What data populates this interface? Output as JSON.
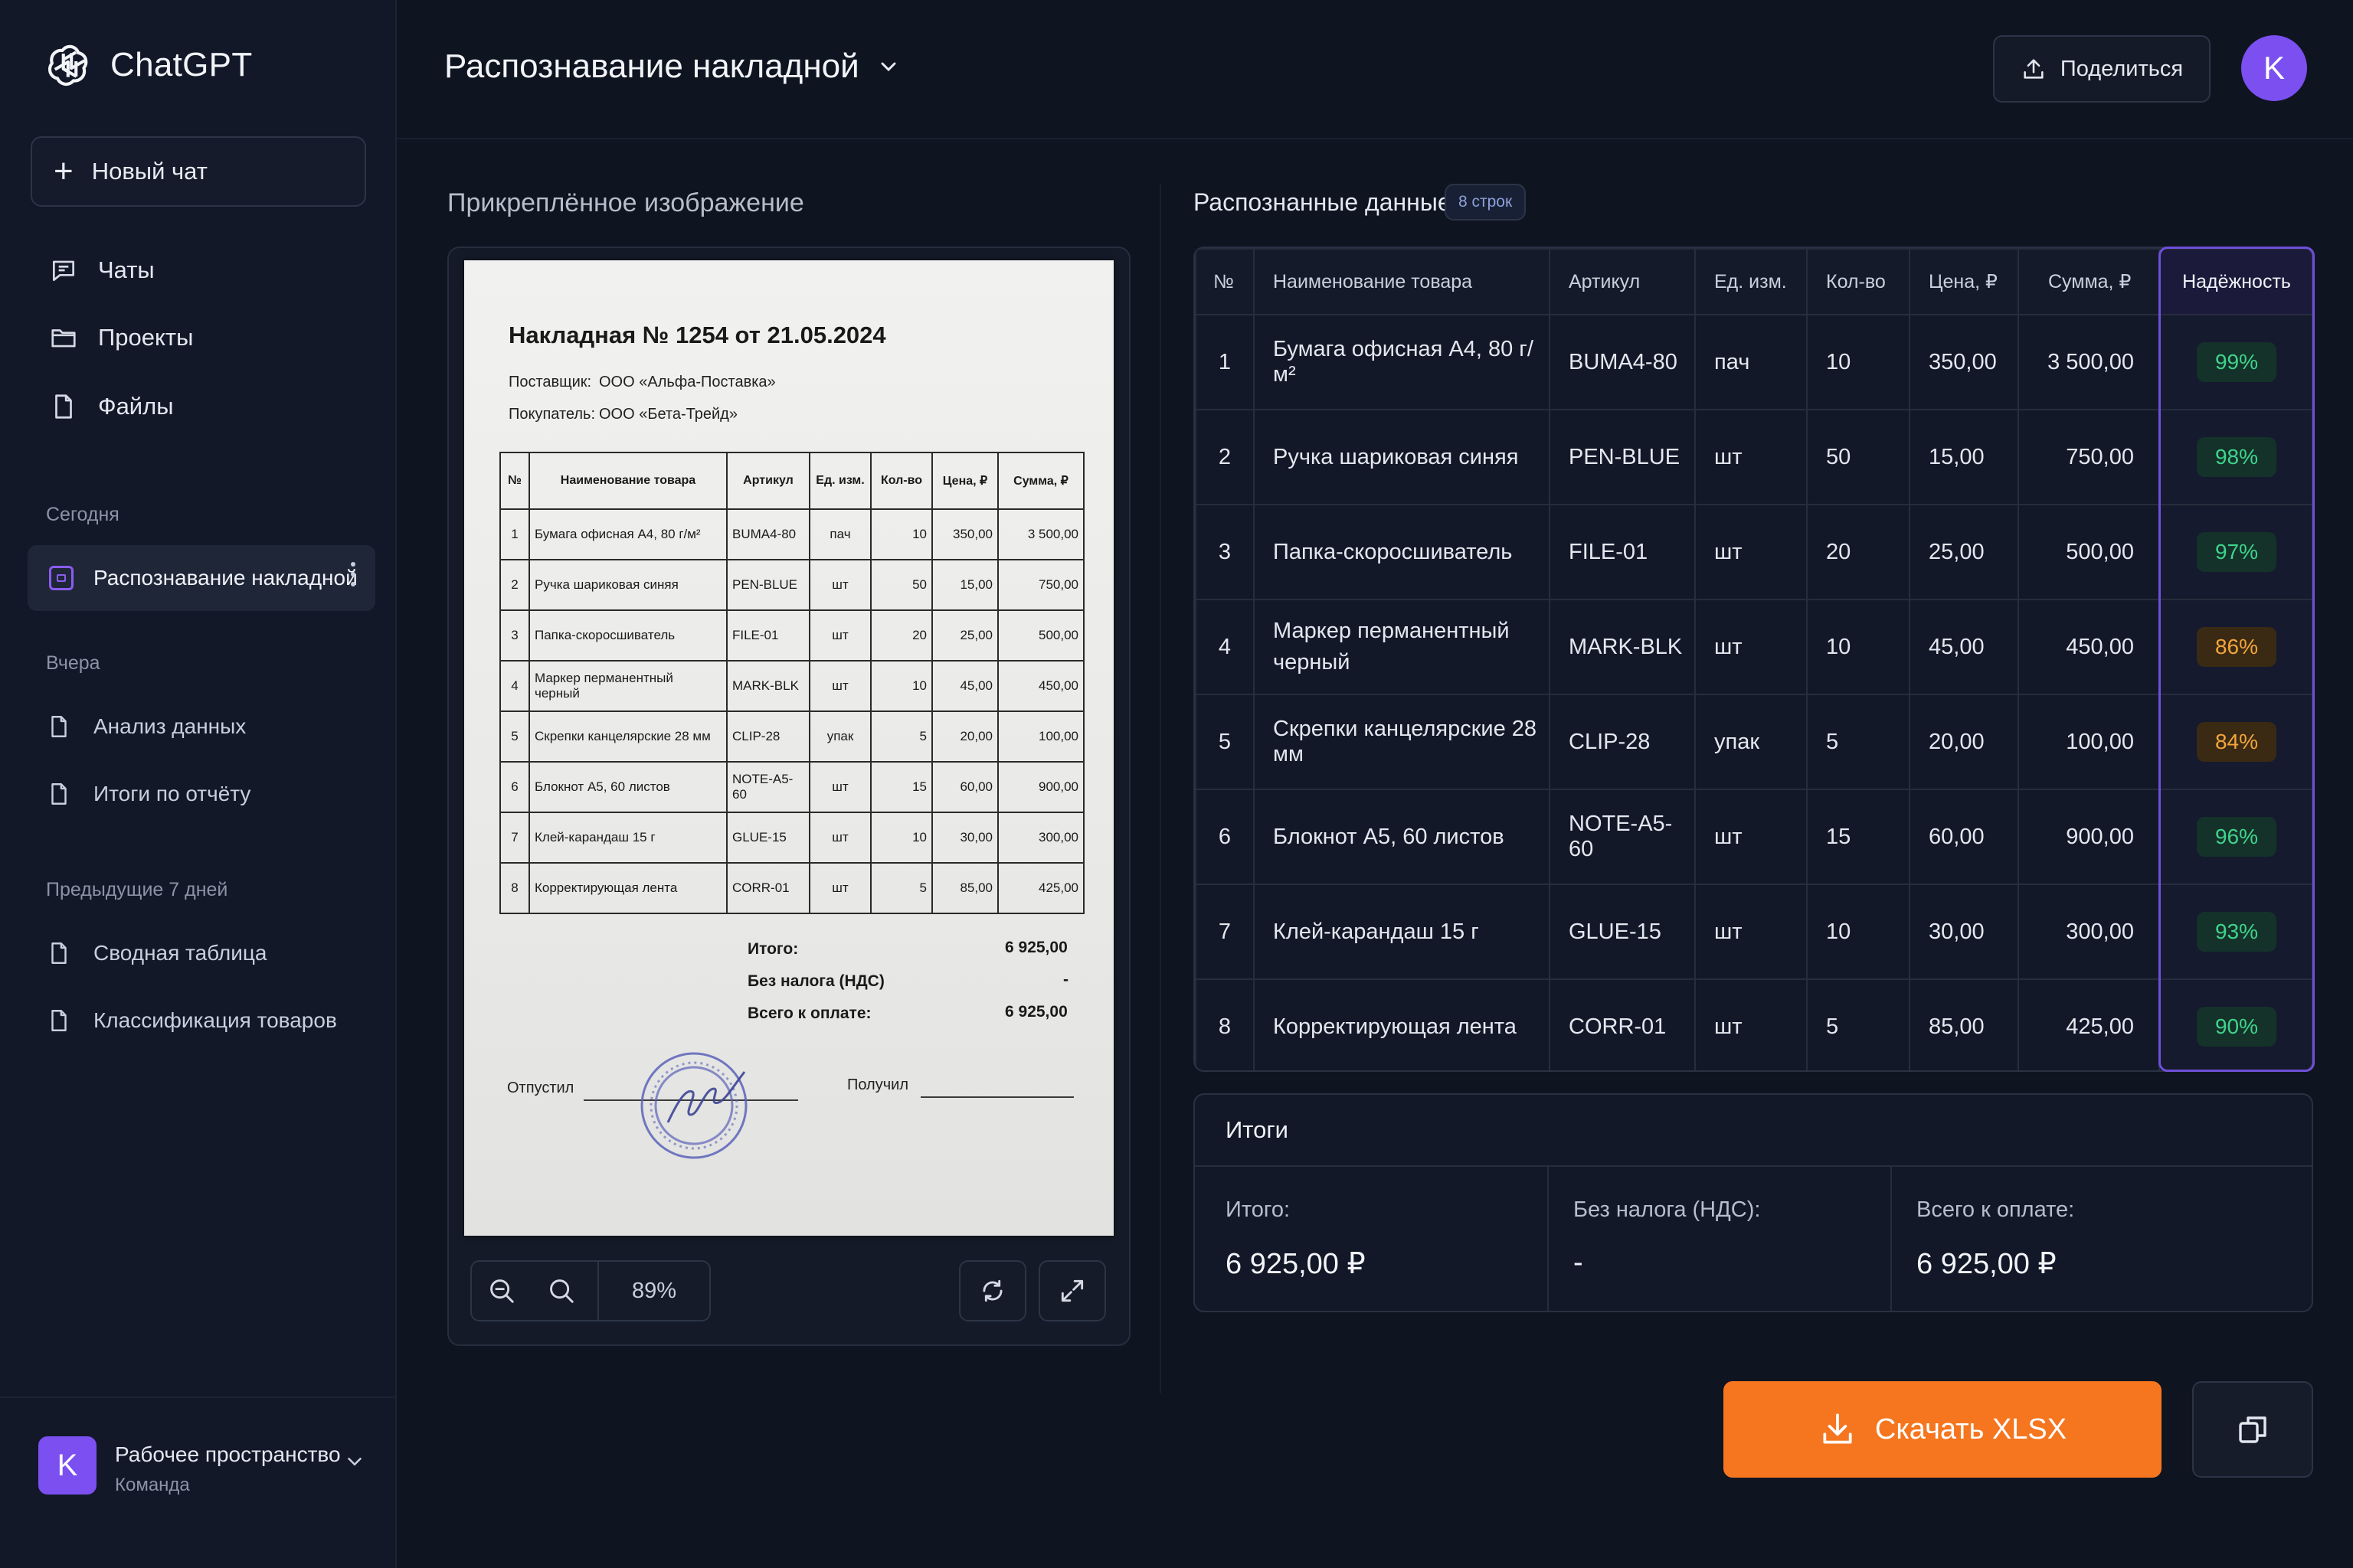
{
  "app": {
    "name": "ChatGPT"
  },
  "sidebar": {
    "new_chat": "Новый чат",
    "nav": [
      {
        "label": "Чаты",
        "icon": "chat-icon"
      },
      {
        "label": "Проекты",
        "icon": "folder-icon"
      },
      {
        "label": "Файлы",
        "icon": "file-icon"
      }
    ],
    "sections": {
      "today": "Сегодня",
      "yesterday": "Вчера",
      "prev7": "Предыдущие 7 дней"
    },
    "today_items": [
      {
        "label": "Распознавание накладной",
        "active": true
      }
    ],
    "yesterday_items": [
      {
        "label": "Анализ данных"
      },
      {
        "label": "Итоги по отчёту"
      }
    ],
    "prev7_items": [
      {
        "label": "Сводная таблица"
      },
      {
        "label": "Классификация товаров"
      }
    ],
    "workspace": {
      "avatar": "K",
      "title": "Рабочее пространство",
      "subtitle": "Команда"
    }
  },
  "header": {
    "title": "Распознавание накладной",
    "share": "Поделиться",
    "user_avatar": "K"
  },
  "image_panel": {
    "title": "Прикреплённое изображение",
    "zoom": "89%"
  },
  "document": {
    "title": "Накладная № 1254 от 21.05.2024",
    "supplier_label": "Поставщик:",
    "supplier": "ООО «Альфа-Поставка»",
    "buyer_label": "Покупатель:",
    "buyer": "ООО «Бета-Трейд»",
    "headers": [
      "№",
      "Наименование товара",
      "Артикул",
      "Ед. изм.",
      "Кол-во",
      "Цена, ₽",
      "Сумма, ₽"
    ],
    "rows": [
      [
        "1",
        "Бумага офисная А4, 80 г/м²",
        "BUMA4-80",
        "пач",
        "10",
        "350,00",
        "3 500,00"
      ],
      [
        "2",
        "Ручка шариковая синяя",
        "PEN-BLUE",
        "шт",
        "50",
        "15,00",
        "750,00"
      ],
      [
        "3",
        "Папка-скоросшиватель",
        "FILE-01",
        "шт",
        "20",
        "25,00",
        "500,00"
      ],
      [
        "4",
        "Маркер перманентный черный",
        "MARK-BLK",
        "шт",
        "10",
        "45,00",
        "450,00"
      ],
      [
        "5",
        "Скрепки канцелярские 28 мм",
        "CLIP-28",
        "упак",
        "5",
        "20,00",
        "100,00"
      ],
      [
        "6",
        "Блокнот А5, 60 листов",
        "NOTE-A5-60",
        "шт",
        "15",
        "60,00",
        "900,00"
      ],
      [
        "7",
        "Клей-карандаш 15 г",
        "GLUE-15",
        "шт",
        "10",
        "30,00",
        "300,00"
      ],
      [
        "8",
        "Корректирующая лента",
        "CORR-01",
        "шт",
        "5",
        "85,00",
        "425,00"
      ]
    ],
    "total_label": "Итого:",
    "total": "6 925,00",
    "vat_label": "Без налога (НДС)",
    "vat": "-",
    "pay_label": "Всего к оплате:",
    "pay": "6 925,00",
    "released": "Отпустил",
    "received": "Получил"
  },
  "data_panel": {
    "title": "Распознанные данные",
    "rows_badge": "8 строк",
    "headers": [
      "№",
      "Наименование товара",
      "Артикул",
      "Ед. изм.",
      "Кол-во",
      "Цена, ₽",
      "Сумма, ₽",
      "Надёжность"
    ],
    "rows": [
      {
        "n": "1",
        "name": "Бумага офисная А4, 80 г/м²",
        "sku": "BUMA4-80",
        "unit": "пач",
        "qty": "10",
        "price": "350,00",
        "sum": "3 500,00",
        "conf": "99%",
        "level": "hi"
      },
      {
        "n": "2",
        "name": "Ручка шариковая синяя",
        "sku": "PEN-BLUE",
        "unit": "шт",
        "qty": "50",
        "price": "15,00",
        "sum": "750,00",
        "conf": "98%",
        "level": "hi"
      },
      {
        "n": "3",
        "name": "Папка-скоросшиватель",
        "sku": "FILE-01",
        "unit": "шт",
        "qty": "20",
        "price": "25,00",
        "sum": "500,00",
        "conf": "97%",
        "level": "hi"
      },
      {
        "n": "4",
        "name": "Маркер перманентный черный",
        "sku": "MARK-BLK",
        "unit": "шт",
        "qty": "10",
        "price": "45,00",
        "sum": "450,00",
        "conf": "86%",
        "level": "mid"
      },
      {
        "n": "5",
        "name": "Скрепки канцелярские 28 мм",
        "sku": "CLIP-28",
        "unit": "упак",
        "qty": "5",
        "price": "20,00",
        "sum": "100,00",
        "conf": "84%",
        "level": "mid"
      },
      {
        "n": "6",
        "name": "Блокнот А5, 60 листов",
        "sku": "NOTE-A5-60",
        "unit": "шт",
        "qty": "15",
        "price": "60,00",
        "sum": "900,00",
        "conf": "96%",
        "level": "hi"
      },
      {
        "n": "7",
        "name": "Клей-карандаш 15 г",
        "sku": "GLUE-15",
        "unit": "шт",
        "qty": "10",
        "price": "30,00",
        "sum": "300,00",
        "conf": "93%",
        "level": "hi"
      },
      {
        "n": "8",
        "name": "Корректирующая лента",
        "sku": "CORR-01",
        "unit": "шт",
        "qty": "5",
        "price": "85,00",
        "sum": "425,00",
        "conf": "90%",
        "level": "hi"
      }
    ]
  },
  "totals": {
    "title": "Итоги",
    "subtotal_label": "Итого:",
    "subtotal": "6 925,00 ₽",
    "vat_label": "Без налога (НДС):",
    "vat": "-",
    "pay_label": "Всего к оплате:",
    "pay": "6 925,00 ₽"
  },
  "actions": {
    "download": "Скачать XLSX"
  },
  "colors": {
    "accent": "#7c4ff0",
    "download": "#f5761f",
    "high": "#3fd48c",
    "medium": "#f3a53b"
  }
}
